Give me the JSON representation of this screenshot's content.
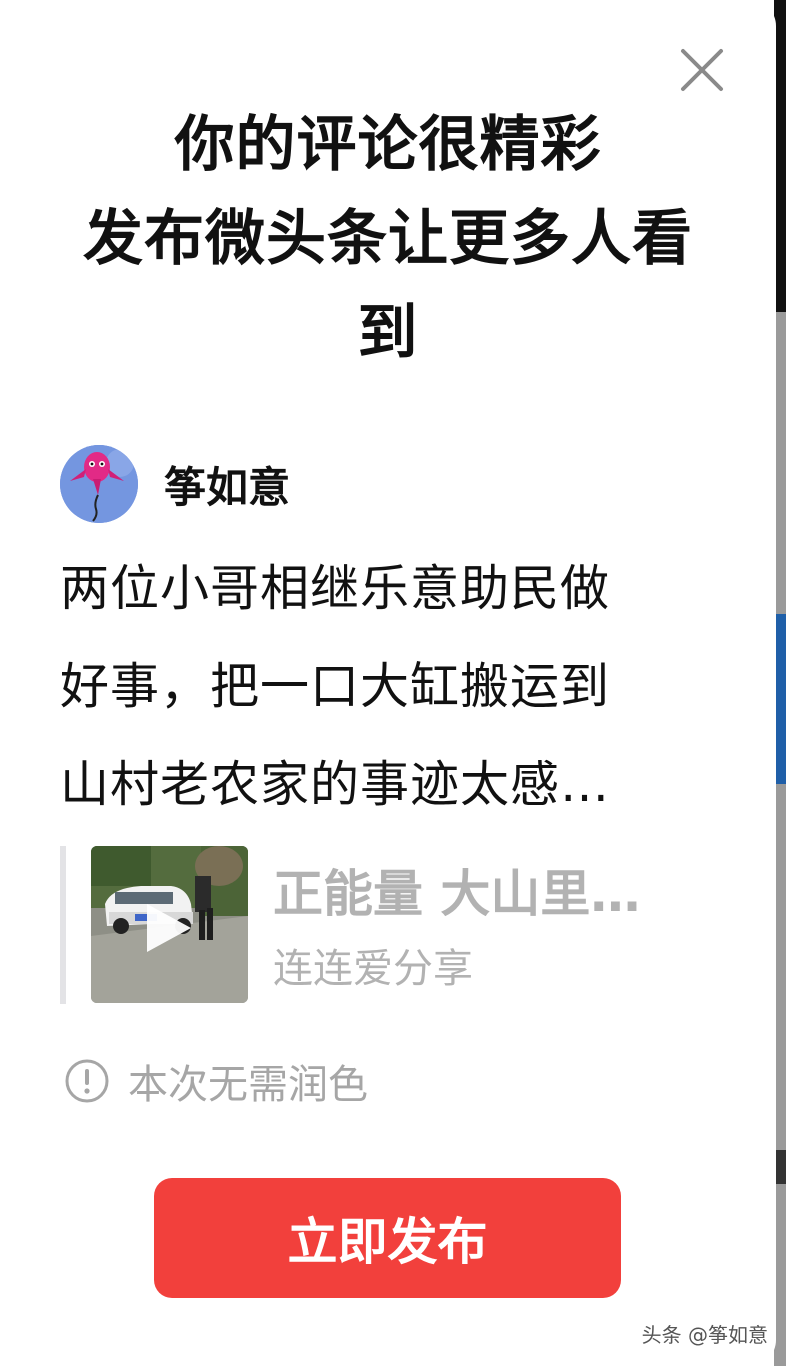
{
  "dialog": {
    "headline_lines": [
      "你的评论很精彩",
      "发布微头条让更多人看",
      "到"
    ],
    "author": {
      "name": "筝如意"
    },
    "post_lines": [
      "两位小哥相继乐意助民做",
      "好事，把一口大缸搬运到",
      "山村老农家的事迹太感…"
    ],
    "quoted_video": {
      "title": "正能量 大山里…",
      "source": "连连爱分享"
    },
    "notice": "本次无需润色",
    "publish_label": "立即发布"
  },
  "watermark": "头条 @筝如意",
  "colors": {
    "publish_button": "#f2403c",
    "muted_text": "#b2b2b2",
    "avatar_bg": "#6f8fdc"
  }
}
